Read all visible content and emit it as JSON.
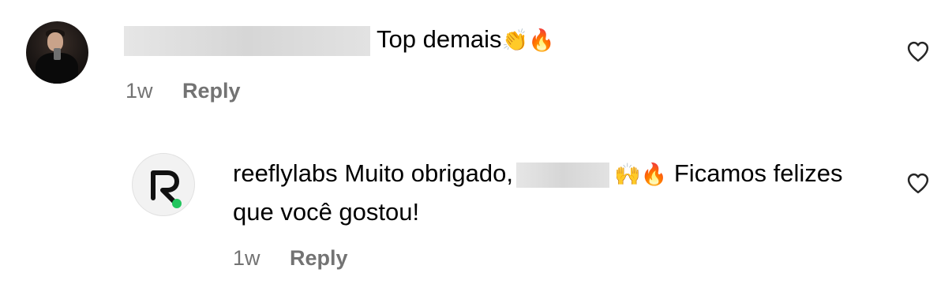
{
  "comments": [
    {
      "text": "Top demais",
      "emojis": "👏🔥",
      "time": "1w",
      "reply_label": "Reply"
    },
    {
      "username": "reeflylabs",
      "text_before": "Muito obrigado,",
      "emojis": "🙌🔥",
      "text_after": "Ficamos felizes que você gostou!",
      "time": "1w",
      "reply_label": "Reply"
    }
  ],
  "icons": {
    "like": "heart-outline-icon"
  },
  "colors": {
    "text": "#000000",
    "meta": "#737373",
    "logo_dot": "#22c55e",
    "redaction": "#dcdcdc"
  }
}
